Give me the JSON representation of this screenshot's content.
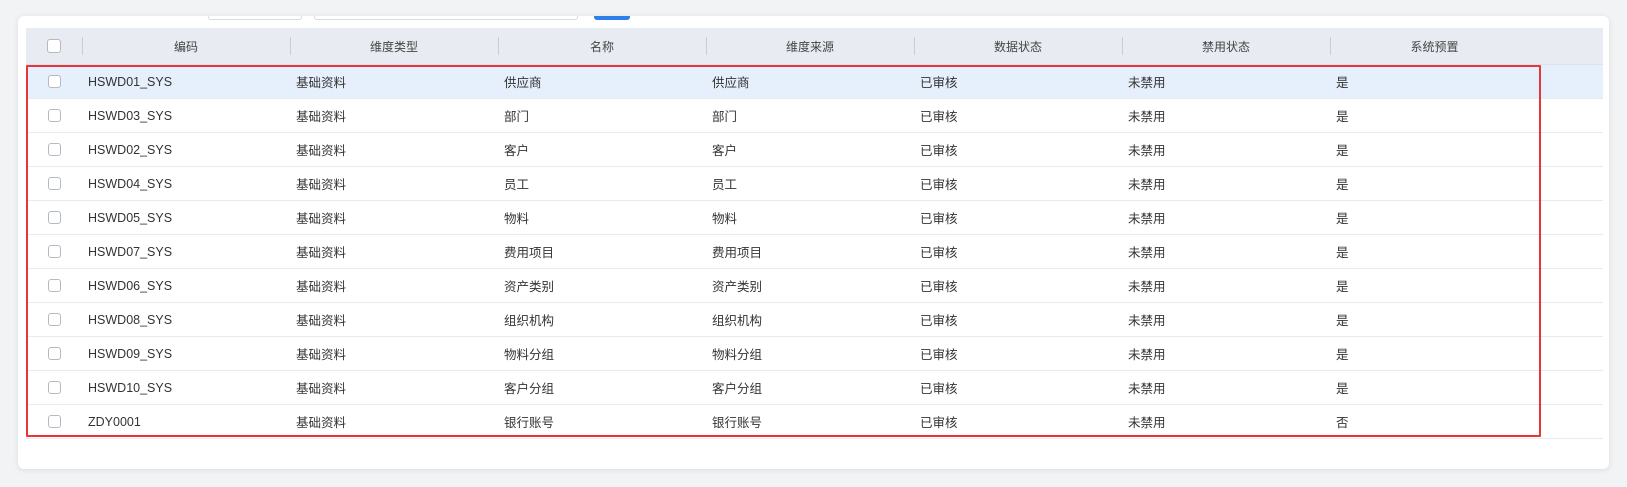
{
  "table": {
    "columns": [
      "编码",
      "维度类型",
      "名称",
      "维度来源",
      "数据状态",
      "禁用状态",
      "系统预置"
    ],
    "rows": [
      [
        "HSWD01_SYS",
        "基础资料",
        "供应商",
        "供应商",
        "已审核",
        "未禁用",
        "是"
      ],
      [
        "HSWD03_SYS",
        "基础资料",
        "部门",
        "部门",
        "已审核",
        "未禁用",
        "是"
      ],
      [
        "HSWD02_SYS",
        "基础资料",
        "客户",
        "客户",
        "已审核",
        "未禁用",
        "是"
      ],
      [
        "HSWD04_SYS",
        "基础资料",
        "员工",
        "员工",
        "已审核",
        "未禁用",
        "是"
      ],
      [
        "HSWD05_SYS",
        "基础资料",
        "物料",
        "物料",
        "已审核",
        "未禁用",
        "是"
      ],
      [
        "HSWD07_SYS",
        "基础资料",
        "费用项目",
        "费用项目",
        "已审核",
        "未禁用",
        "是"
      ],
      [
        "HSWD06_SYS",
        "基础资料",
        "资产类别",
        "资产类别",
        "已审核",
        "未禁用",
        "是"
      ],
      [
        "HSWD08_SYS",
        "基础资料",
        "组织机构",
        "组织机构",
        "已审核",
        "未禁用",
        "是"
      ],
      [
        "HSWD09_SYS",
        "基础资料",
        "物料分组",
        "物料分组",
        "已审核",
        "未禁用",
        "是"
      ],
      [
        "HSWD10_SYS",
        "基础资料",
        "客户分组",
        "客户分组",
        "已审核",
        "未禁用",
        "是"
      ],
      [
        "ZDY0001",
        "基础资料",
        "银行账号",
        "银行账号",
        "已审核",
        "未禁用",
        "否"
      ]
    ],
    "selected_row": 0
  },
  "colors": {
    "header_bg": "#e8ecf2",
    "selected_row_bg": "#e6effc",
    "highlight_border": "#e8353a",
    "accent": "#2f7fe8"
  }
}
